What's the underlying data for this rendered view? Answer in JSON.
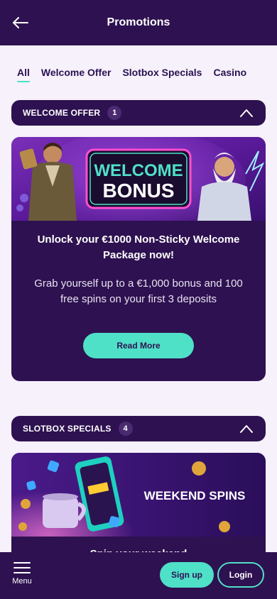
{
  "header": {
    "title": "Promotions",
    "back_icon": "arrow-left-icon"
  },
  "tabs": [
    {
      "label": "All",
      "active": true
    },
    {
      "label": "Welcome Offer",
      "active": false
    },
    {
      "label": "Slotbox Specials",
      "active": false
    },
    {
      "label": "Casino",
      "active": false
    }
  ],
  "sections": {
    "welcome": {
      "title": "WELCOME OFFER",
      "count": "1",
      "expanded": true
    },
    "slotbox": {
      "title": "SLOTBOX SPECIALS",
      "count": "4",
      "expanded": true
    }
  },
  "welcome_card": {
    "banner_line1": "WELCOME",
    "banner_line2": "BONUS",
    "headline": "Unlock your €1000 Non-Sticky Welcome Package now!",
    "description": "Grab yourself up to a €1,000 bonus and 100 free spins on your first 3 deposits",
    "button_label": "Read More"
  },
  "slotbox_card": {
    "banner_text": "WEEKEND SPINS",
    "title_peek": "Spin your weekend"
  },
  "bottom_bar": {
    "menu_label": "Menu",
    "signup_label": "Sign up",
    "login_label": "Login"
  },
  "colors": {
    "primary_dark": "#2e1150",
    "accent_teal": "#4fe0c8",
    "page_bg": "#f6f1fb"
  }
}
